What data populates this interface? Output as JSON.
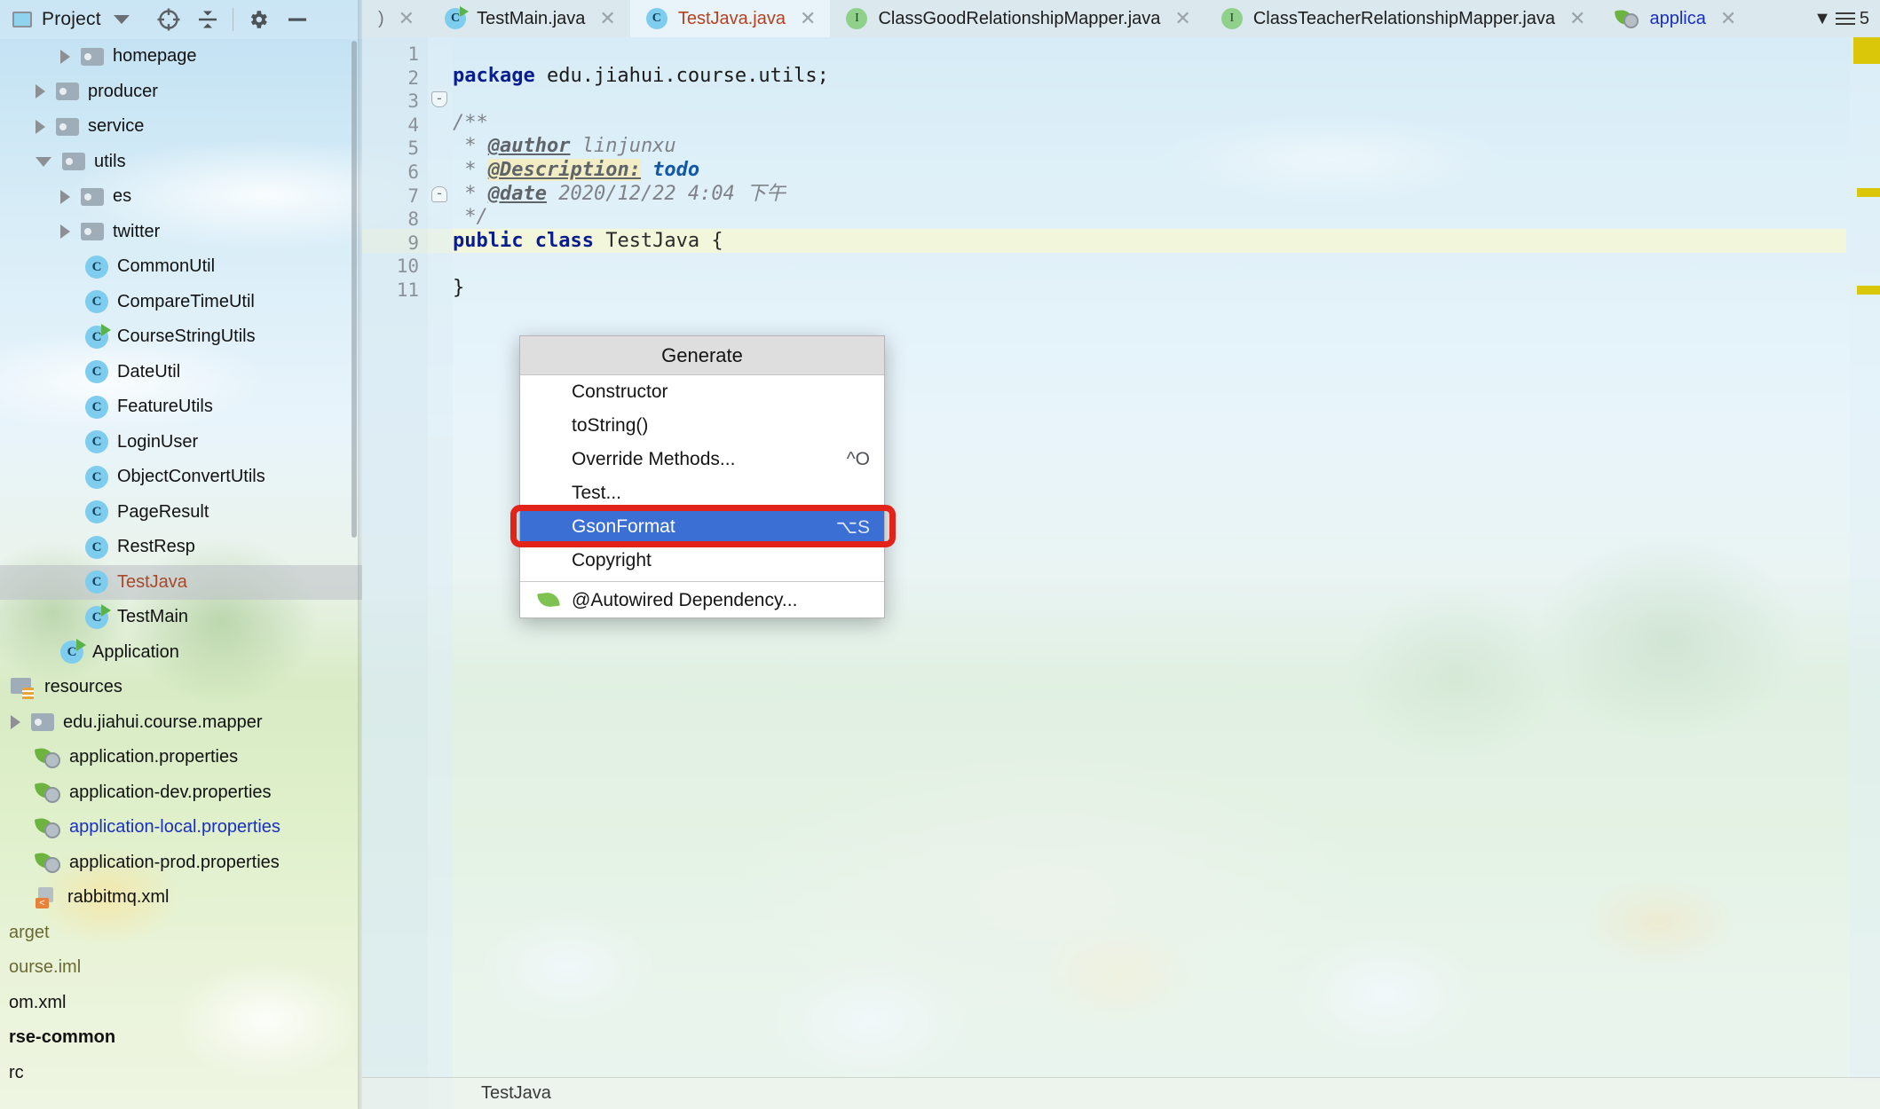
{
  "project_panel": {
    "title": "Project",
    "toolbar": [
      {
        "name": "project-view-icon",
        "glyph": "▣"
      },
      {
        "name": "chevron-down-icon",
        "glyph": "▼"
      },
      {
        "name": "locate-target-icon",
        "glyph": "⊕"
      },
      {
        "name": "collapse-all-icon",
        "glyph": "⤒⤓"
      },
      {
        "name": "settings-gear-icon",
        "glyph": "⚙"
      },
      {
        "name": "hide-window-icon",
        "glyph": "—"
      }
    ],
    "tree": [
      {
        "label": "homepage",
        "type": "folder",
        "indent": 68,
        "arrow": "closed",
        "selected": false
      },
      {
        "label": "producer",
        "type": "folder",
        "indent": 40,
        "arrow": "closed",
        "selected": false
      },
      {
        "label": "service",
        "type": "folder",
        "indent": 40,
        "arrow": "closed",
        "selected": false
      },
      {
        "label": "utils",
        "type": "folder",
        "indent": 40,
        "arrow": "open",
        "selected": false
      },
      {
        "label": "es",
        "type": "folder",
        "indent": 68,
        "arrow": "closed",
        "selected": false
      },
      {
        "label": "twitter",
        "type": "folder",
        "indent": 68,
        "arrow": "closed",
        "selected": false
      },
      {
        "label": "CommonUtil",
        "type": "class",
        "indent": 96,
        "arrow": "none",
        "selected": false
      },
      {
        "label": "CompareTimeUtil",
        "type": "class",
        "indent": 96,
        "arrow": "none",
        "selected": false
      },
      {
        "label": "CourseStringUtils",
        "type": "class-run",
        "indent": 96,
        "arrow": "none",
        "selected": false
      },
      {
        "label": "DateUtil",
        "type": "class",
        "indent": 96,
        "arrow": "none",
        "selected": false
      },
      {
        "label": "FeatureUtils",
        "type": "class",
        "indent": 96,
        "arrow": "none",
        "selected": false
      },
      {
        "label": "LoginUser",
        "type": "class",
        "indent": 96,
        "arrow": "none",
        "selected": false
      },
      {
        "label": "ObjectConvertUtils",
        "type": "class",
        "indent": 96,
        "arrow": "none",
        "selected": false
      },
      {
        "label": "PageResult",
        "type": "class",
        "indent": 96,
        "arrow": "none",
        "selected": false
      },
      {
        "label": "RestResp",
        "type": "class",
        "indent": 96,
        "arrow": "none",
        "selected": false
      },
      {
        "label": "TestJava",
        "type": "class",
        "indent": 96,
        "arrow": "none",
        "selected": true,
        "style": "selected-file"
      },
      {
        "label": "TestMain",
        "type": "class-run",
        "indent": 96,
        "arrow": "none",
        "selected": false
      },
      {
        "label": "Application",
        "type": "spring-class",
        "indent": 68,
        "arrow": "none",
        "selected": false
      },
      {
        "label": "resources",
        "type": "resources",
        "indent": 12,
        "arrow": "none",
        "selected": false
      },
      {
        "label": "edu.jiahui.course.mapper",
        "type": "folder",
        "indent": 12,
        "arrow": "closed",
        "selected": false
      },
      {
        "label": "application.properties",
        "type": "spring",
        "indent": 40,
        "arrow": "none",
        "selected": false
      },
      {
        "label": "application-dev.properties",
        "type": "spring",
        "indent": 40,
        "arrow": "none",
        "selected": false
      },
      {
        "label": "application-local.properties",
        "type": "spring",
        "indent": 40,
        "arrow": "none",
        "selected": false,
        "style": "blue"
      },
      {
        "label": "application-prod.properties",
        "type": "spring",
        "indent": 40,
        "arrow": "none",
        "selected": false
      },
      {
        "label": "rabbitmq.xml",
        "type": "xml",
        "indent": 40,
        "arrow": "none",
        "selected": false
      },
      {
        "label": "arget",
        "type": "none",
        "indent": -8,
        "arrow": "none",
        "selected": false,
        "style": "olive"
      },
      {
        "label": "ourse.iml",
        "type": "none",
        "indent": -8,
        "arrow": "none",
        "selected": false,
        "style": "olive"
      },
      {
        "label": "om.xml",
        "type": "none",
        "indent": -8,
        "arrow": "none",
        "selected": false
      },
      {
        "label": "rse-common",
        "type": "none",
        "indent": -8,
        "arrow": "none",
        "selected": false,
        "style": "bold"
      },
      {
        "label": "rc",
        "type": "none",
        "indent": -8,
        "arrow": "none",
        "selected": false
      }
    ]
  },
  "editor": {
    "tabs": [
      {
        "label": "TestMain.java",
        "icon": "class-run-icon",
        "active": false,
        "modified": false
      },
      {
        "label": "TestJava.java",
        "icon": "class-icon",
        "active": true,
        "modified": true
      },
      {
        "label": "ClassGoodRelationshipMapper.java",
        "icon": "interface-icon",
        "active": false,
        "modified": false
      },
      {
        "label": "ClassTeacherRelationshipMapper.java",
        "icon": "interface-icon",
        "active": false,
        "modified": false
      },
      {
        "label": "applica",
        "icon": "spring-file-icon",
        "active": false,
        "modified": false
      }
    ],
    "overflow_count": "5",
    "line_numbers": [
      "1",
      "2",
      "3",
      "4",
      "5",
      "6",
      "7",
      "8",
      "9",
      "10",
      "11"
    ],
    "current_line": "9",
    "breadcrumb": "TestJava",
    "code": {
      "l1_kw": "package",
      "l1_rest": " edu.jiahui.course.utils;",
      "l3": "/**",
      "l4_star": " * ",
      "l4_tag": "@author",
      "l4_val": " linjunxu",
      "l5_star": " * ",
      "l5_tag": "@Description:",
      "l5_val": "todo",
      "l6_star": " * ",
      "l6_tag": "@date",
      "l6_val": " 2020/12/22 4:04 下午",
      "l7": " */",
      "l8_kw": "public class",
      "l8_name": " TestJava {",
      "l10": "}"
    }
  },
  "generate_popup": {
    "title": "Generate",
    "items": [
      {
        "label": "Constructor",
        "shortcut": "",
        "highlighted": false,
        "icon": "none",
        "separator_before": false
      },
      {
        "label": "toString()",
        "shortcut": "",
        "highlighted": false,
        "icon": "none",
        "separator_before": false
      },
      {
        "label": "Override Methods...",
        "shortcut": "^O",
        "highlighted": false,
        "icon": "none",
        "separator_before": false
      },
      {
        "label": "Test...",
        "shortcut": "",
        "highlighted": false,
        "icon": "none",
        "separator_before": false
      },
      {
        "label": "GsonFormat",
        "shortcut": "⌥S",
        "highlighted": true,
        "icon": "none",
        "separator_before": false
      },
      {
        "label": "Copyright",
        "shortcut": "",
        "highlighted": false,
        "icon": "none",
        "separator_before": false
      },
      {
        "label": "@Autowired Dependency...",
        "shortcut": "",
        "highlighted": false,
        "icon": "leaf-icon",
        "separator_before": true
      }
    ],
    "annotation_color": "#e2231a",
    "highlight_color": "#3b6fd4"
  }
}
